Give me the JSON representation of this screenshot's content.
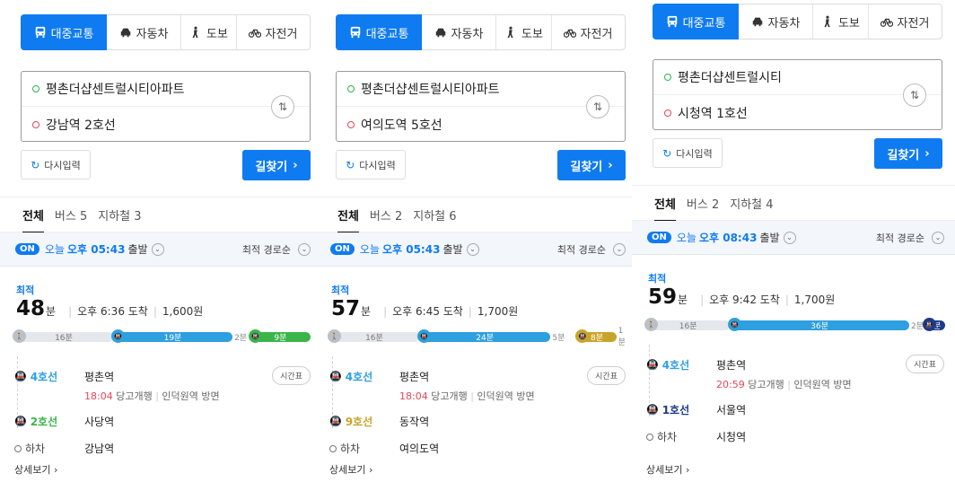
{
  "panels": [
    {
      "modes": [
        {
          "label": "대중교통"
        },
        {
          "label": "자동차"
        },
        {
          "label": "도보"
        },
        {
          "label": "자전거"
        }
      ],
      "origin": "평촌더샵센트럴시티아파트",
      "destination": "강남역 2호선",
      "reset_label": "다시입력",
      "search_label": "길찾기",
      "tabs": [
        {
          "label": "전체"
        },
        {
          "label": "버스 5"
        },
        {
          "label": "지하철 3"
        }
      ],
      "on_badge": "ON",
      "today": "오늘",
      "time": "오후 05:43",
      "depart": "출발",
      "sort": "최적 경로순",
      "best": "최적",
      "minutes": "48",
      "min_unit": "분",
      "arrive": "오후 6:36 도착",
      "fare": "1,600원",
      "bar": [
        {
          "type": "walk",
          "label": "16분",
          "ratio": 0.33,
          "color": "#e4e7eb"
        },
        {
          "type": "subway",
          "label": "19분",
          "ratio": 0.4,
          "color": "#2e9fdf"
        },
        {
          "type": "gap",
          "label": "2분",
          "ratio": 0.06
        },
        {
          "type": "subway",
          "label": "9분",
          "ratio": 0.2,
          "color": "#3bb54a"
        }
      ],
      "steps": [
        {
          "line": "4호선",
          "station": "평촌역",
          "color": "#2e9fdf",
          "show_timetable": true,
          "timetable": "시간표",
          "sub_time": "18:04",
          "sub_text": "당고개행",
          "sub_dir": "인덕원역 방면"
        },
        {
          "line": "2호선",
          "station": "사당역",
          "color": "#3bb54a"
        },
        {
          "line": "하차",
          "station": "강남역",
          "color": "#777"
        }
      ],
      "detail": "상세보기"
    },
    {
      "modes": [
        {
          "label": "대중교통"
        },
        {
          "label": "자동차"
        },
        {
          "label": "도보"
        },
        {
          "label": "자전거"
        }
      ],
      "origin": "평촌더샵센트럴시티아파트",
      "destination": "여의도역 5호선",
      "reset_label": "다시입력",
      "search_label": "길찾기",
      "tabs": [
        {
          "label": "전체"
        },
        {
          "label": "버스 2"
        },
        {
          "label": "지하철 6"
        }
      ],
      "on_badge": "ON",
      "today": "오늘",
      "time": "오후 05:43",
      "depart": "출발",
      "sort": "최적 경로순",
      "best": "최적",
      "minutes": "57",
      "min_unit": "분",
      "arrive": "오후 6:45 도착",
      "fare": "1,700원",
      "bar": [
        {
          "type": "walk",
          "label": "16분",
          "ratio": 0.3,
          "color": "#e4e7eb"
        },
        {
          "type": "subway",
          "label": "24분",
          "ratio": 0.44,
          "color": "#2e9fdf"
        },
        {
          "type": "gap",
          "label": "5분",
          "ratio": 0.09
        },
        {
          "type": "subway",
          "label": "8분",
          "ratio": 0.13,
          "color": "#c9a42a"
        },
        {
          "type": "gap",
          "label": "1분",
          "ratio": 0.04
        }
      ],
      "steps": [
        {
          "line": "4호선",
          "station": "평촌역",
          "color": "#2e9fdf",
          "show_timetable": true,
          "timetable": "시간표",
          "sub_time": "18:04",
          "sub_text": "당고개행",
          "sub_dir": "인덕원역 방면"
        },
        {
          "line": "9호선",
          "station": "동작역",
          "color": "#c9a42a"
        },
        {
          "line": "하차",
          "station": "여의도역",
          "color": "#777"
        }
      ],
      "detail": "상세보기"
    },
    {
      "modes": [
        {
          "label": "대중교통"
        },
        {
          "label": "자동차"
        },
        {
          "label": "도보"
        },
        {
          "label": "자전거"
        }
      ],
      "origin": "평촌더샵센트럴시티",
      "destination": "시청역 1호선",
      "reset_label": "다시입력",
      "search_label": "길찾기",
      "tabs": [
        {
          "label": "전체"
        },
        {
          "label": "버스 2"
        },
        {
          "label": "지하철 4"
        }
      ],
      "on_badge": "ON",
      "today": "오늘",
      "time": "오후 08:43",
      "depart": "출발",
      "sort": "최적 경로순",
      "best": "최적",
      "minutes": "59",
      "min_unit": "분",
      "arrive": "오후 9:42 도착",
      "fare": "1,700원",
      "bar": [
        {
          "type": "walk",
          "label": "16분",
          "ratio": 0.28,
          "color": "#e4e7eb"
        },
        {
          "type": "subway",
          "label": "36분",
          "ratio": 0.6,
          "color": "#2e9fdf"
        },
        {
          "type": "gap",
          "label": "2분",
          "ratio": 0.05
        },
        {
          "type": "subway",
          "label": "2분",
          "ratio": 0.07,
          "color": "#1d3a8a"
        }
      ],
      "steps": [
        {
          "line": "4호선",
          "station": "평촌역",
          "color": "#2e9fdf",
          "show_timetable": true,
          "timetable": "시간표",
          "sub_time": "20:59",
          "sub_text": "당고개행",
          "sub_dir": "인덕원역 방면"
        },
        {
          "line": "1호선",
          "station": "서울역",
          "color": "#1d3a8a"
        },
        {
          "line": "하차",
          "station": "시청역",
          "color": "#777"
        }
      ],
      "detail": "상세보기"
    }
  ]
}
